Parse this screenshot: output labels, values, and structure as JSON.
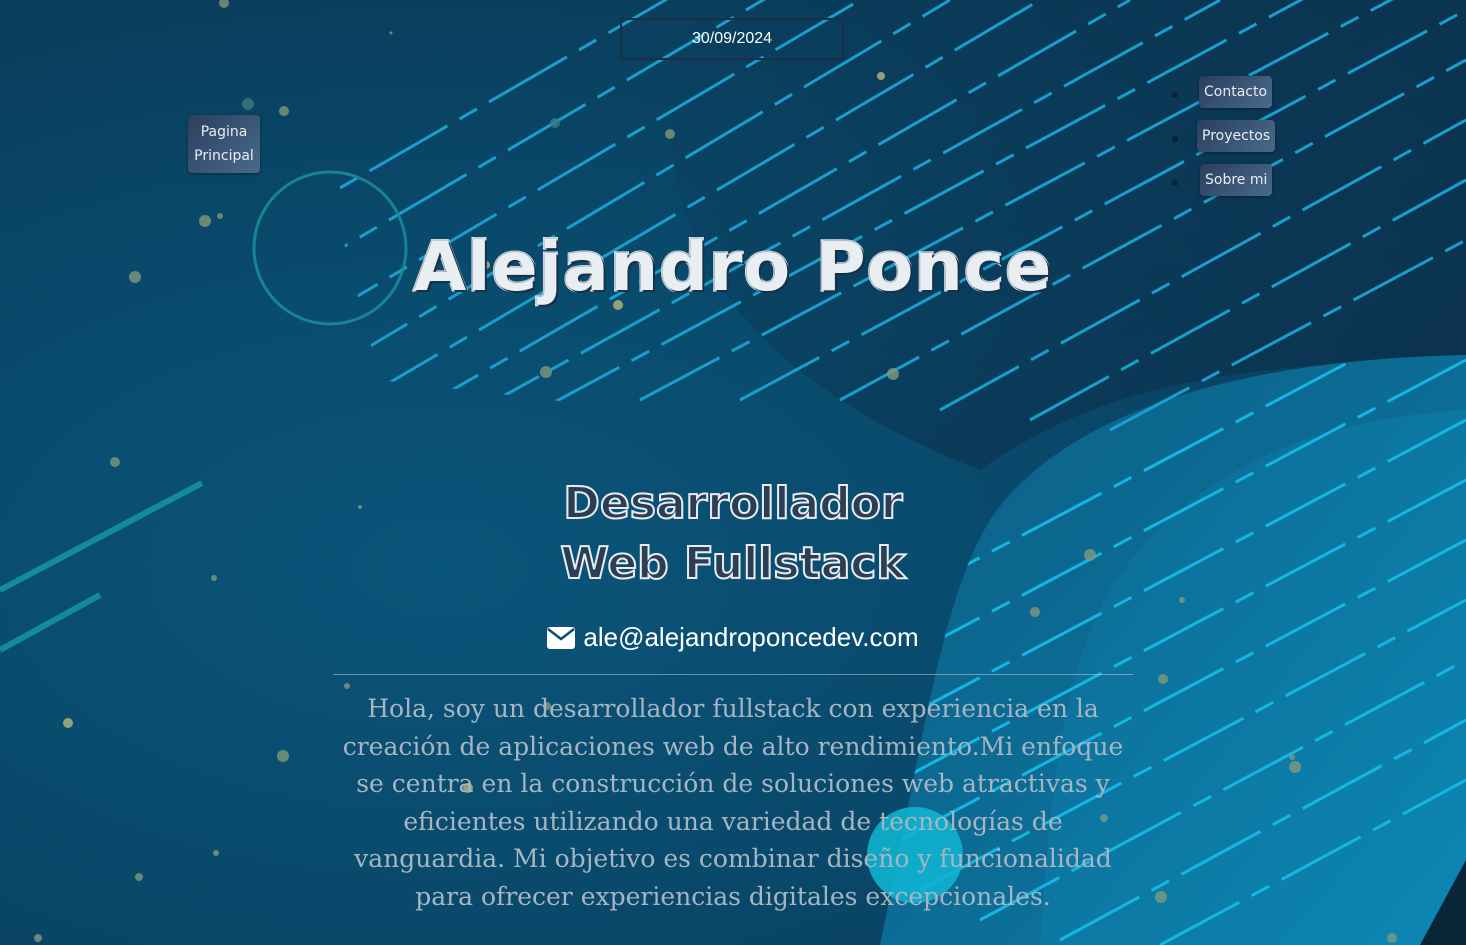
{
  "header": {
    "date": "30/09/2024",
    "home_button": "Pagina Principal"
  },
  "nav": {
    "items": [
      {
        "label": "Contacto"
      },
      {
        "label": "Proyectos"
      },
      {
        "label": "Sobre mi"
      }
    ]
  },
  "hero": {
    "name": "Alejandro Ponce",
    "role_line1": "Desarrollador",
    "role_line2": "Web Fullstack",
    "email": "ale@alejandroponcedev.com",
    "email_icon": "envelope-icon",
    "bio": "Hola, soy un desarrollador fullstack con experiencia en la creación de aplicaciones web de alto rendimiento.Mi enfoque se centra en la construcción de soluciones web atractivas y eficientes utilizando una variedad de tecnologías de vanguardia. Mi objetivo es combinar diseño y funcionalidad para ofrecer experiencias digitales excepcionales."
  },
  "colors": {
    "background": "#0b4a6b",
    "accent_cyan": "#1ab8e0",
    "button_gradient_start": "#2a3f5e",
    "button_gradient_end": "#4a6a8a",
    "text_white": "#ffffff",
    "bio_text": "#a6b5c2"
  }
}
